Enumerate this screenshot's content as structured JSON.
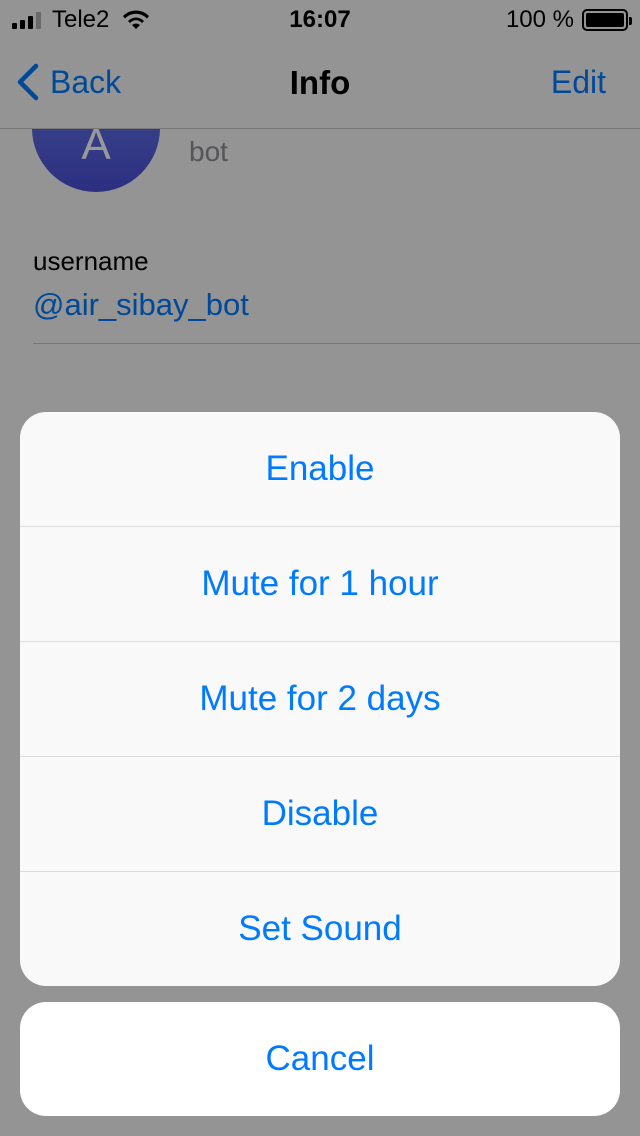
{
  "status_bar": {
    "carrier": "Tele2",
    "time": "16:07",
    "battery": "100 %"
  },
  "nav": {
    "back_label": "Back",
    "title": "Info",
    "edit_label": "Edit"
  },
  "profile": {
    "avatar_letter": "A",
    "subtitle": "bot"
  },
  "info": {
    "username_label": "username",
    "username_value": "@air_sibay_bot"
  },
  "action_sheet": {
    "items": [
      {
        "label": "Enable"
      },
      {
        "label": "Mute for 1 hour"
      },
      {
        "label": "Mute for 2 days"
      },
      {
        "label": "Disable"
      },
      {
        "label": "Set Sound"
      }
    ],
    "cancel_label": "Cancel"
  }
}
